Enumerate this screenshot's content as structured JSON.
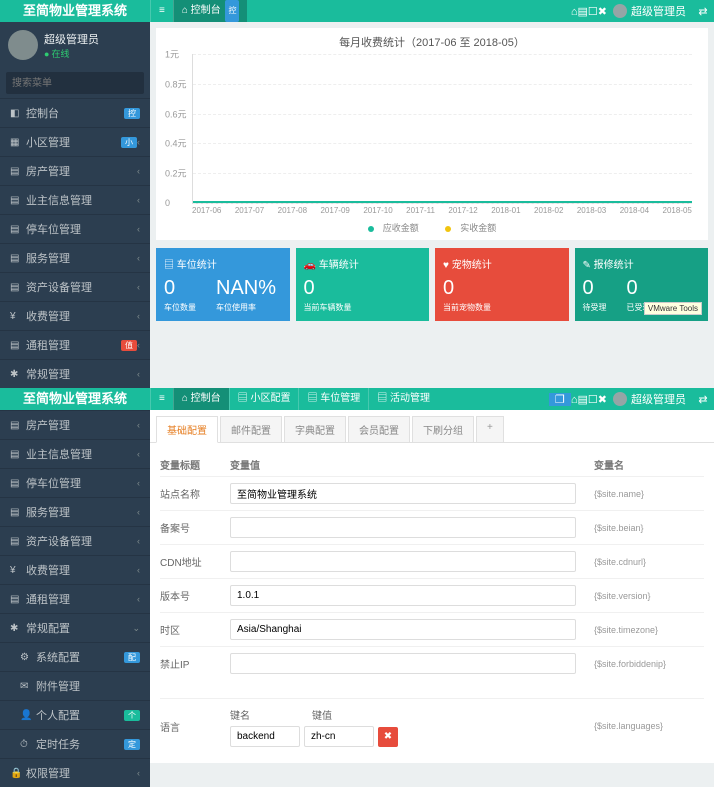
{
  "brand": "至简物业管理系统",
  "top1": {
    "menu_icon": "≡",
    "dashboard": "控制台",
    "dashboard_badge": "控",
    "icons": [
      "⌂",
      "▤",
      "☐",
      "✖"
    ],
    "user": "超级管理员",
    "share": "⇄"
  },
  "sidebar1": {
    "user_name": "超级管理员",
    "user_status": "在线",
    "search_placeholder": "搜索菜单",
    "items": [
      {
        "icon": "◧",
        "label": "控制台",
        "badge": "控",
        "badge_cls": "bg-blue"
      },
      {
        "icon": "▦",
        "label": "小区管理",
        "badge": "小",
        "badge_cls": "bg-blue",
        "chev": "‹"
      },
      {
        "icon": "▤",
        "label": "房产管理",
        "chev": "‹"
      },
      {
        "icon": "▤",
        "label": "业主信息管理",
        "chev": "‹"
      },
      {
        "icon": "▤",
        "label": "停车位管理",
        "chev": "‹"
      },
      {
        "icon": "▤",
        "label": "服务管理",
        "chev": "‹"
      },
      {
        "icon": "▤",
        "label": "资产设备管理",
        "chev": "‹"
      },
      {
        "icon": "¥",
        "label": "收费管理",
        "chev": "‹"
      },
      {
        "icon": "▤",
        "label": "通租管理",
        "badge": "值",
        "badge_cls": "bg-red",
        "chev": "‹"
      },
      {
        "icon": "✱",
        "label": "常规管理",
        "chev": "‹"
      }
    ]
  },
  "chart_data": {
    "type": "line",
    "title": "每月收费统计（2017-06 至 2018-05）",
    "xlabel": "",
    "ylabel": "",
    "yticks": [
      "1元",
      "0.8元",
      "0.6元",
      "0.4元",
      "0.2元",
      "0"
    ],
    "ylim": [
      0,
      1
    ],
    "categories": [
      "2017-06",
      "2017-07",
      "2017-08",
      "2017-09",
      "2017-10",
      "2017-11",
      "2017-12",
      "2018-01",
      "2018-02",
      "2018-03",
      "2018-04",
      "2018-05"
    ],
    "series": [
      {
        "name": "应收金额",
        "color": "#1abc9c",
        "values": [
          0,
          0,
          0,
          0,
          0,
          0,
          0,
          0,
          0,
          0,
          0,
          0
        ]
      },
      {
        "name": "实收金额",
        "color": "#f1c40f",
        "values": [
          0,
          0,
          0,
          0,
          0,
          0,
          0,
          0,
          0,
          0,
          0,
          0
        ]
      }
    ]
  },
  "stats": [
    {
      "cls": "st-blue",
      "icon": "▤",
      "title": "车位统计",
      "vals": [
        {
          "v": "0",
          "l": "车位数量"
        },
        {
          "v": "NAN%",
          "l": "车位使用率"
        }
      ]
    },
    {
      "cls": "st-teal",
      "icon": "🚗",
      "title": "车辆统计",
      "vals": [
        {
          "v": "0",
          "l": "当前车辆数量"
        }
      ]
    },
    {
      "cls": "st-red",
      "icon": "♥",
      "title": "宠物统计",
      "vals": [
        {
          "v": "0",
          "l": "当前宠物数量"
        }
      ]
    },
    {
      "cls": "st-cyan",
      "icon": "✎",
      "title": "报修统计",
      "vals": [
        {
          "v": "0",
          "l": "待受理"
        },
        {
          "v": "0",
          "l": "已受理"
        }
      ],
      "tooltip": "VMware Tools"
    }
  ],
  "top2": {
    "nav": [
      {
        "icon": "⌂",
        "label": "控制台"
      },
      {
        "icon": "▤",
        "label": "小区配置"
      },
      {
        "icon": "▤",
        "label": "车位管理"
      },
      {
        "icon": "▤",
        "label": "活动管理"
      }
    ],
    "right_badge": "❐",
    "icons": [
      "⌂",
      "▤",
      "☐",
      "✖"
    ],
    "user": "超级管理员"
  },
  "sidebar2": {
    "items": [
      {
        "icon": "▤",
        "label": "房产管理",
        "chev": "‹"
      },
      {
        "icon": "▤",
        "label": "业主信息管理",
        "chev": "‹"
      },
      {
        "icon": "▤",
        "label": "停车位管理",
        "chev": "‹"
      },
      {
        "icon": "▤",
        "label": "服务管理",
        "chev": "‹"
      },
      {
        "icon": "▤",
        "label": "资产设备管理",
        "chev": "‹"
      },
      {
        "icon": "¥",
        "label": "收费管理",
        "chev": "‹"
      },
      {
        "icon": "▤",
        "label": "通租管理",
        "chev": "‹"
      },
      {
        "icon": "✱",
        "label": "常规配置",
        "chev": "⌄",
        "active": true
      },
      {
        "icon": "⚙",
        "label": "系统配置",
        "badge": "配",
        "badge_cls": "bg-blue",
        "sub": true
      },
      {
        "icon": "✉",
        "label": "附件管理",
        "sub": true
      },
      {
        "icon": "👤",
        "label": "个人配置",
        "badge": "个",
        "badge_cls": "bg-cyan",
        "sub": true
      },
      {
        "icon": "⏱",
        "label": "定时任务",
        "badge": "定",
        "badge_cls": "bg-blue",
        "sub": true
      },
      {
        "icon": "🔒",
        "label": "权限管理",
        "chev": "‹"
      }
    ]
  },
  "tabs": [
    "基础配置",
    "邮件配置",
    "字典配置",
    "会员配置",
    "下刷分组"
  ],
  "form": {
    "headers": {
      "label": "变量标题",
      "value": "变量值",
      "name": "变量名"
    },
    "rows": [
      {
        "label": "站点名称",
        "value": "至简物业管理系统",
        "name": "{$site.name}"
      },
      {
        "label": "备案号",
        "value": "",
        "name": "{$site.beian}"
      },
      {
        "label": "CDN地址",
        "value": "",
        "name": "{$site.cdnurl}"
      },
      {
        "label": "版本号",
        "value": "1.0.1",
        "name": "{$site.version}"
      },
      {
        "label": "时区",
        "value": "Asia/Shanghai",
        "name": "{$site.timezone}"
      },
      {
        "label": "禁止IP",
        "value": "",
        "name": "{$site.forbiddenip}"
      }
    ],
    "lang": {
      "label": "语言",
      "key_hdr": "键名",
      "val_hdr": "键值",
      "key": "backend",
      "val": "zh-cn",
      "name": "{$site.languages}"
    }
  }
}
